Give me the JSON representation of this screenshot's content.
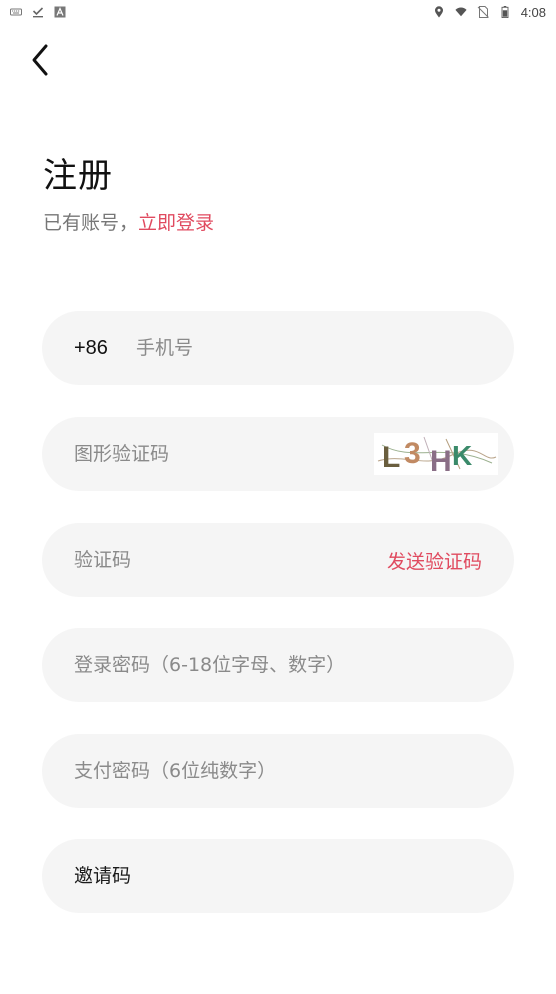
{
  "status_bar": {
    "time": "4:08",
    "left_icons": [
      "keyboard-icon",
      "download-done-icon",
      "a-icon"
    ],
    "right_icons": [
      "location-icon",
      "wifi-icon",
      "no-sim-icon",
      "battery-icon"
    ]
  },
  "header": {
    "back_icon": "chevron-left-icon",
    "title": "注册",
    "login_prompt": "已有账号，",
    "login_link": "立即登录"
  },
  "form": {
    "phone": {
      "country_code": "+86",
      "placeholder": "手机号",
      "value": ""
    },
    "captcha": {
      "placeholder": "图形验证码",
      "value": "",
      "image_text": "L3HK"
    },
    "sms_code": {
      "placeholder": "验证码",
      "value": "",
      "send_label": "发送验证码"
    },
    "login_password": {
      "placeholder": "登录密码（6-18位字母、数字）",
      "value": ""
    },
    "pay_password": {
      "placeholder": "支付密码（6位纯数字）",
      "value": ""
    },
    "invite_code": {
      "placeholder": "邀请码",
      "value": ""
    }
  },
  "colors": {
    "accent": "#e04a5f",
    "field_bg": "#f5f5f5",
    "placeholder": "#8a8a8a"
  }
}
